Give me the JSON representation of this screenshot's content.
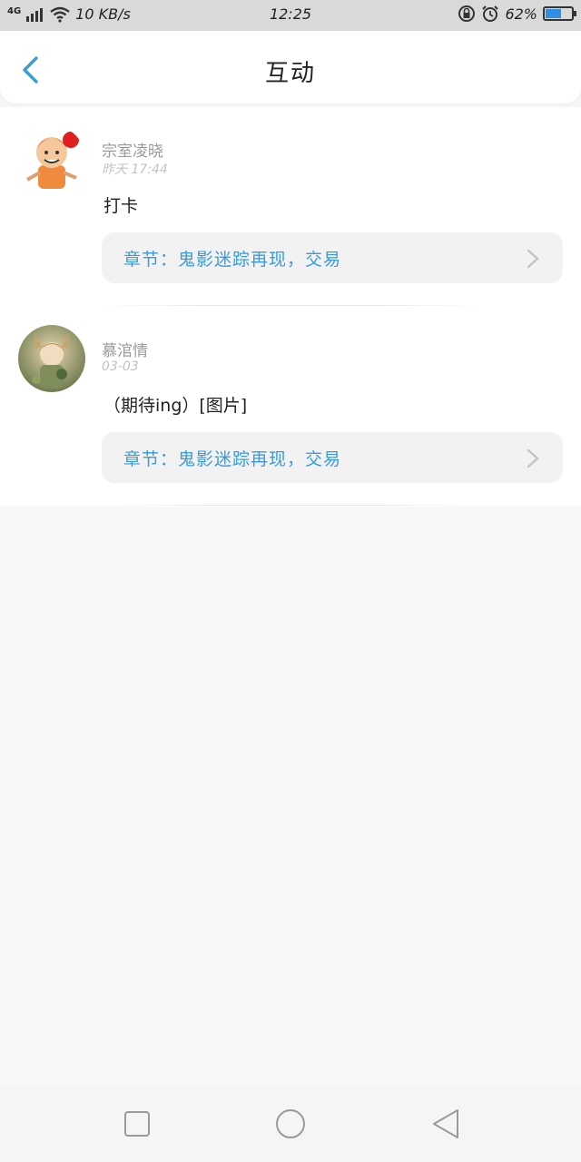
{
  "status_bar": {
    "signal": "4G",
    "speed": "10 KB/s",
    "time": "12:25",
    "battery": "62%",
    "battery_level": 0.62
  },
  "header": {
    "title": "互动"
  },
  "colors": {
    "accent": "#3a9bd8",
    "background": "#f7f7f7"
  },
  "items": [
    {
      "user": "宗室凌晓",
      "time": "昨天 17:44",
      "message": "打卡",
      "chapter": "章节：鬼影迷踪再现，交易"
    },
    {
      "user": "慕涫情",
      "time": "03-03",
      "message": "（期待ing）[图片]",
      "chapter": "章节：鬼影迷踪再现，交易"
    }
  ],
  "nav": {
    "icons": [
      "recent-apps-icon",
      "home-icon",
      "back-icon"
    ]
  }
}
